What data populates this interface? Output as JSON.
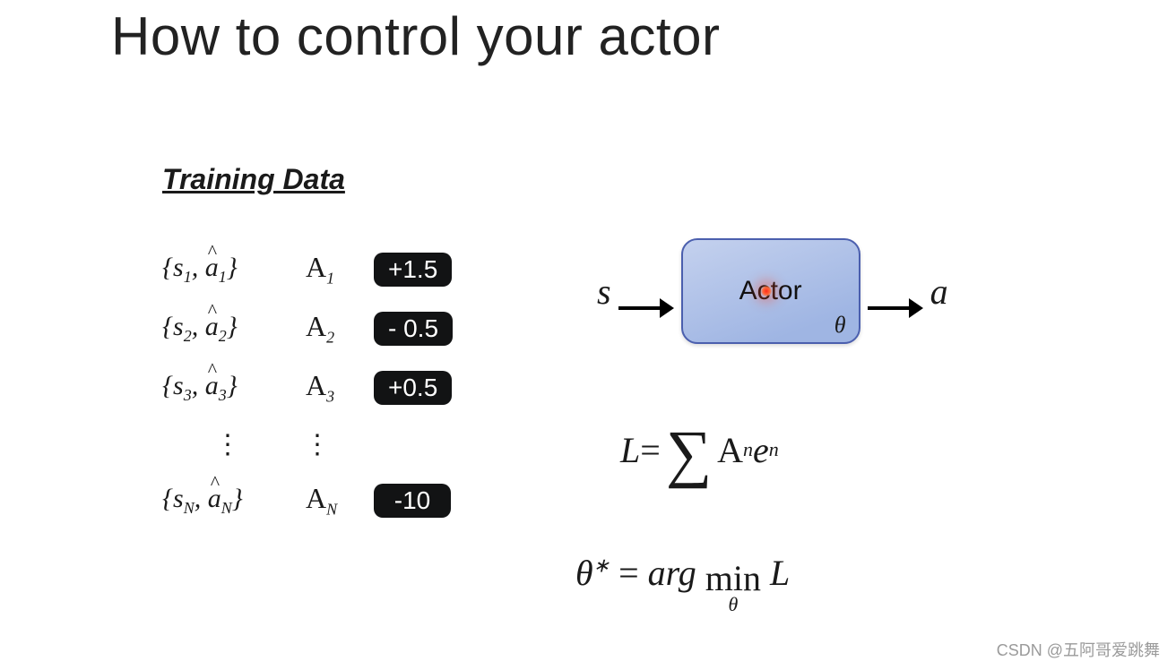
{
  "title": "How to control your actor",
  "training_header": "Training Data",
  "rows": [
    {
      "s_sub": "1",
      "a_sub": "1",
      "A_sub": "1",
      "value": "+1.5"
    },
    {
      "s_sub": "2",
      "a_sub": "2",
      "A_sub": "2",
      "value": "- 0.5"
    },
    {
      "s_sub": "3",
      "a_sub": "3",
      "A_sub": "3",
      "value": "+0.5"
    }
  ],
  "last_row": {
    "s_sub": "N",
    "a_sub": "N",
    "A_sub": "N",
    "value": "-10"
  },
  "diagram": {
    "input": "s",
    "box": "Actor",
    "param": "θ",
    "output": "a"
  },
  "eq1": {
    "L": "L",
    "eq": " = ",
    "A": "A",
    "n1": "n",
    "e": "e",
    "n2": "n"
  },
  "eq2": {
    "theta": "θ",
    "star": "∗",
    "eq": " = ",
    "arg": "arg ",
    "min": "min",
    "sub": "θ",
    "L": " L"
  },
  "dots": "⋮",
  "watermark": "CSDN @五阿哥爱跳舞"
}
